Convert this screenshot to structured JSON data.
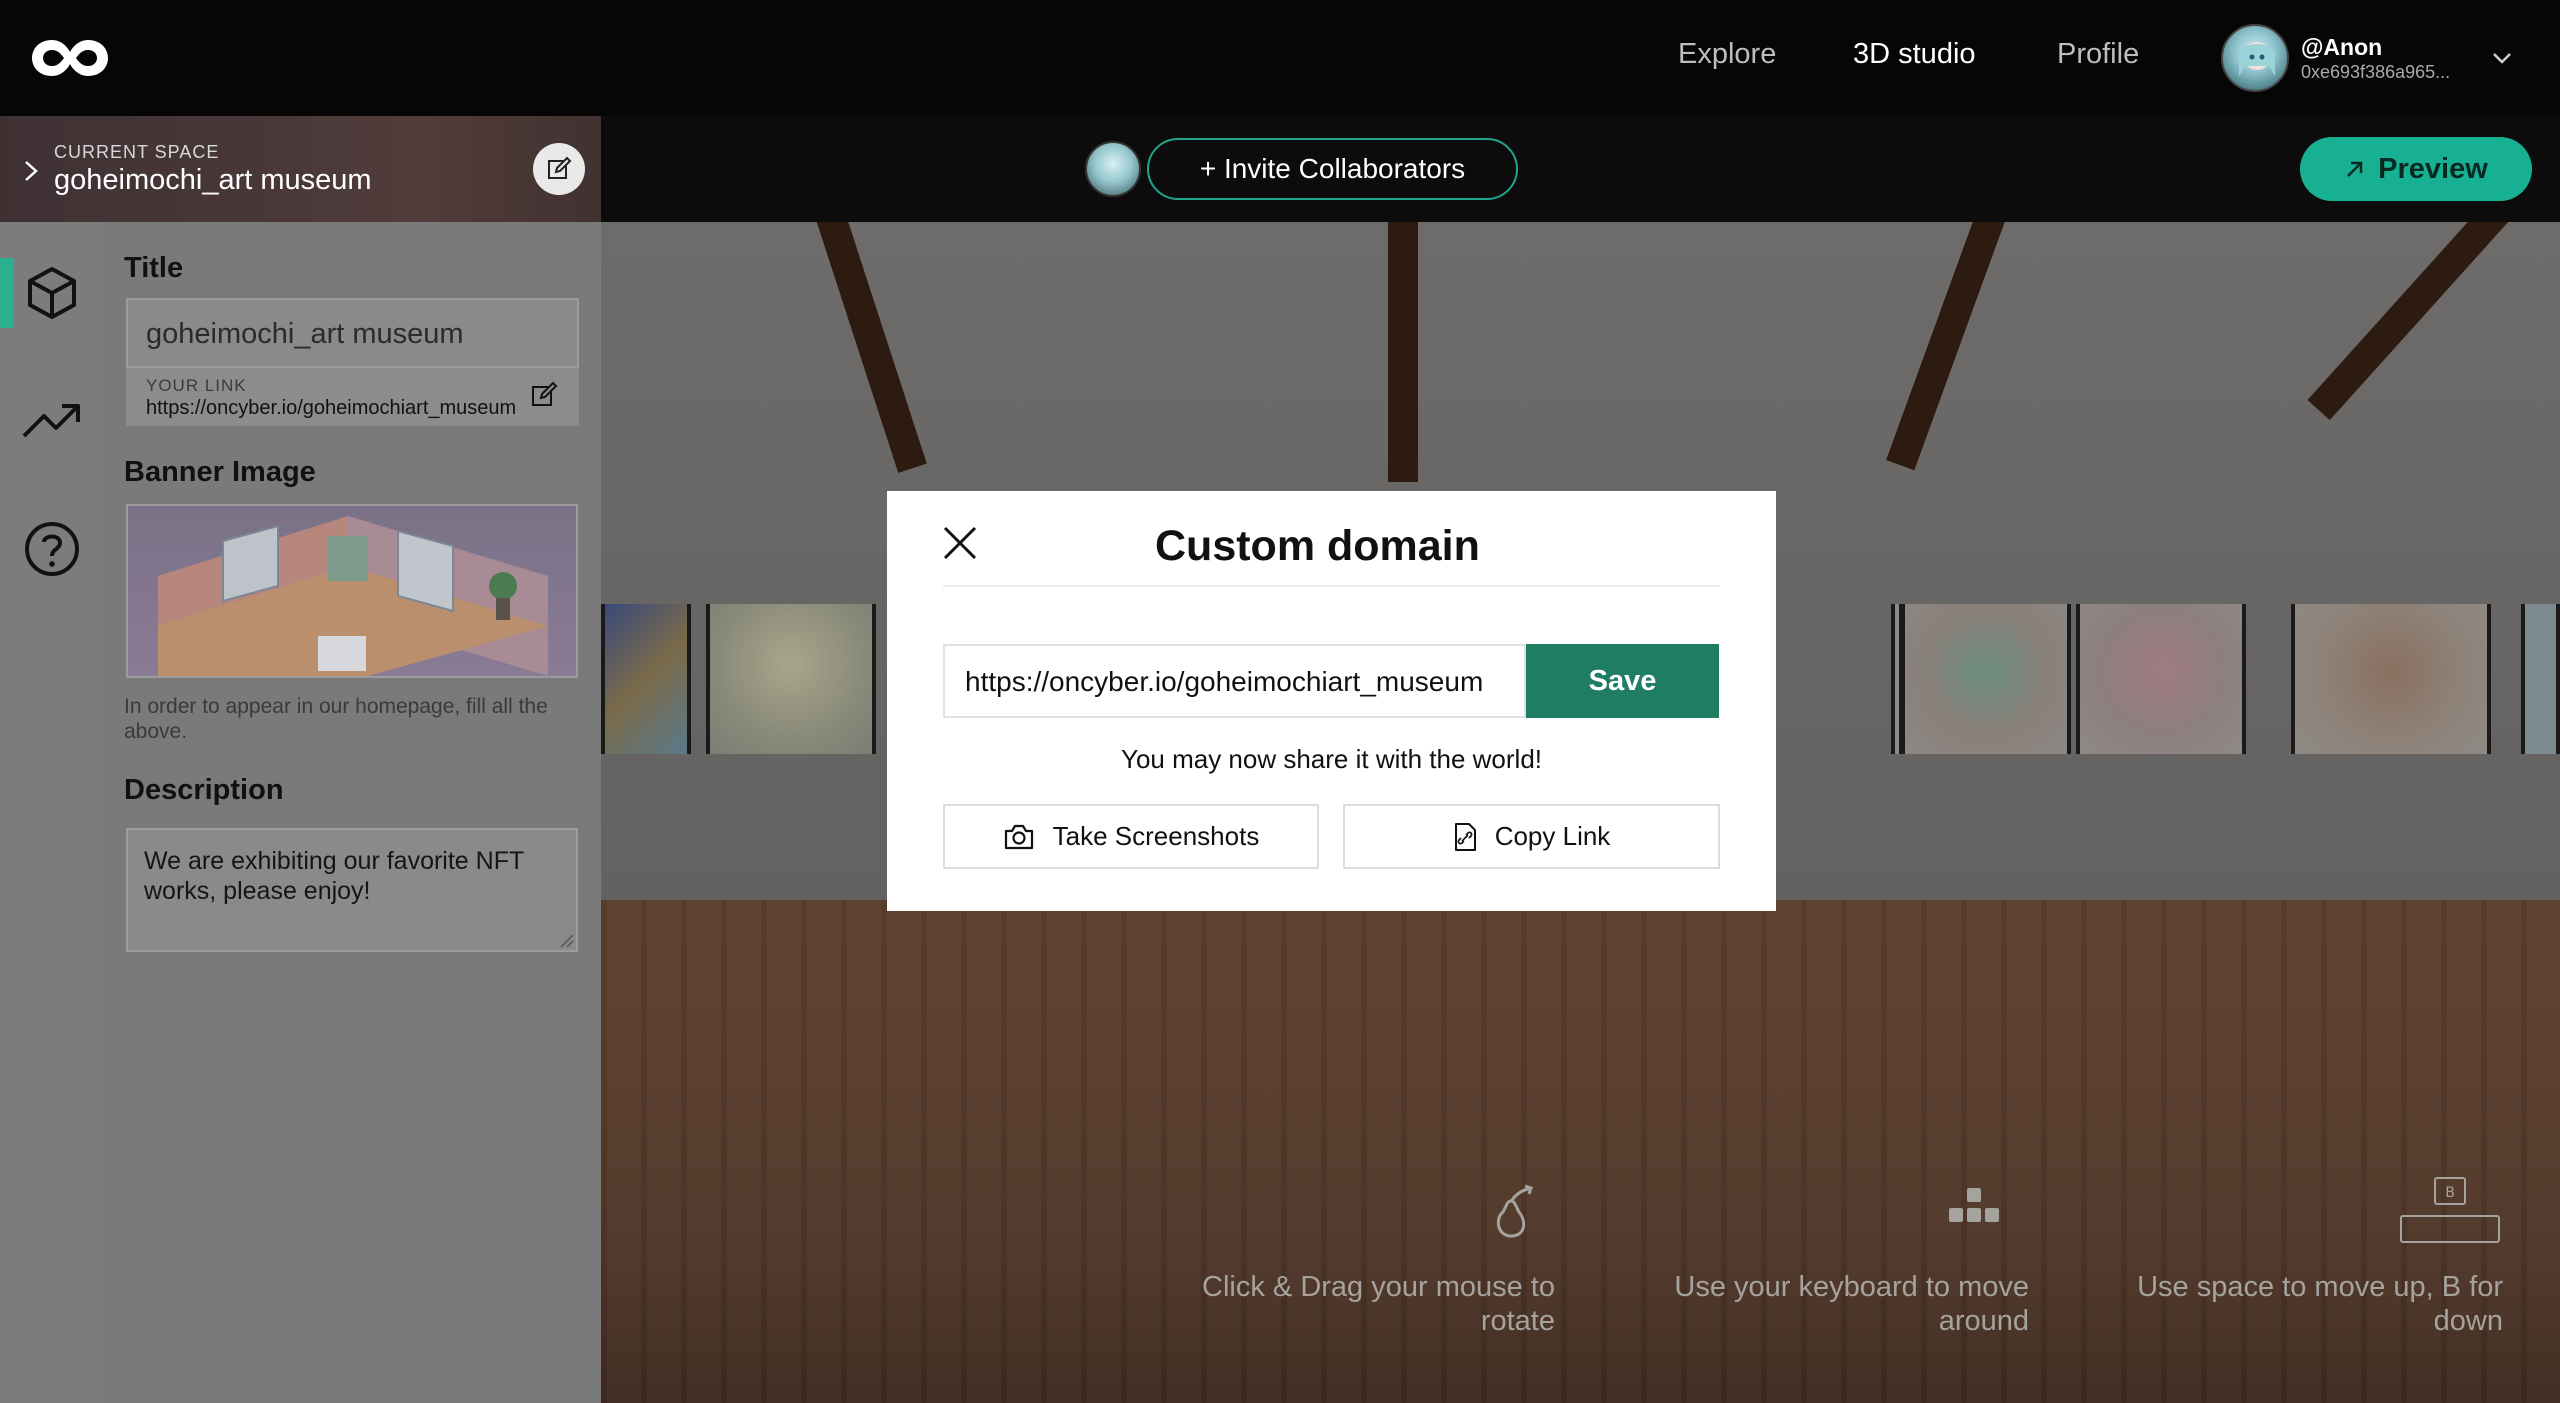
{
  "nav": {
    "links": [
      "Explore",
      "3D studio",
      "Profile"
    ],
    "user_name": "@Anon",
    "user_address": "0xe693f386a965..."
  },
  "subbar": {
    "space_label": "CURRENT SPACE",
    "space_name": "goheimochi_art museum",
    "invite_label": "+ Invite Collaborators",
    "preview_label": "Preview"
  },
  "panel": {
    "title_heading": "Title",
    "title_value": "goheimochi_art museum",
    "link_label": "YOUR LINK",
    "link_url": "https://oncyber.io/goheimochiart_museum",
    "banner_heading": "Banner Image",
    "hint": "In order to appear in our homepage, fill all the above.",
    "description_heading": "Description",
    "description_value": "We are exhibiting our favorite NFT works, please enjoy!"
  },
  "modal": {
    "title": "Custom domain",
    "domain_value": "https://oncyber.io/goheimochiart_museum",
    "save_label": "Save",
    "share_text": "You may now share it with the world!",
    "screenshot_label": "Take Screenshots",
    "copy_label": "Copy Link"
  },
  "instructions": {
    "mouse": "Click & Drag your mouse to rotate",
    "keyboard": "Use your keyboard to move around",
    "space": "Use space to move up, B for down",
    "space_key_letter": "B"
  },
  "colors": {
    "accent": "#18b093",
    "save": "#1f7d63",
    "topbar": "#060606"
  }
}
